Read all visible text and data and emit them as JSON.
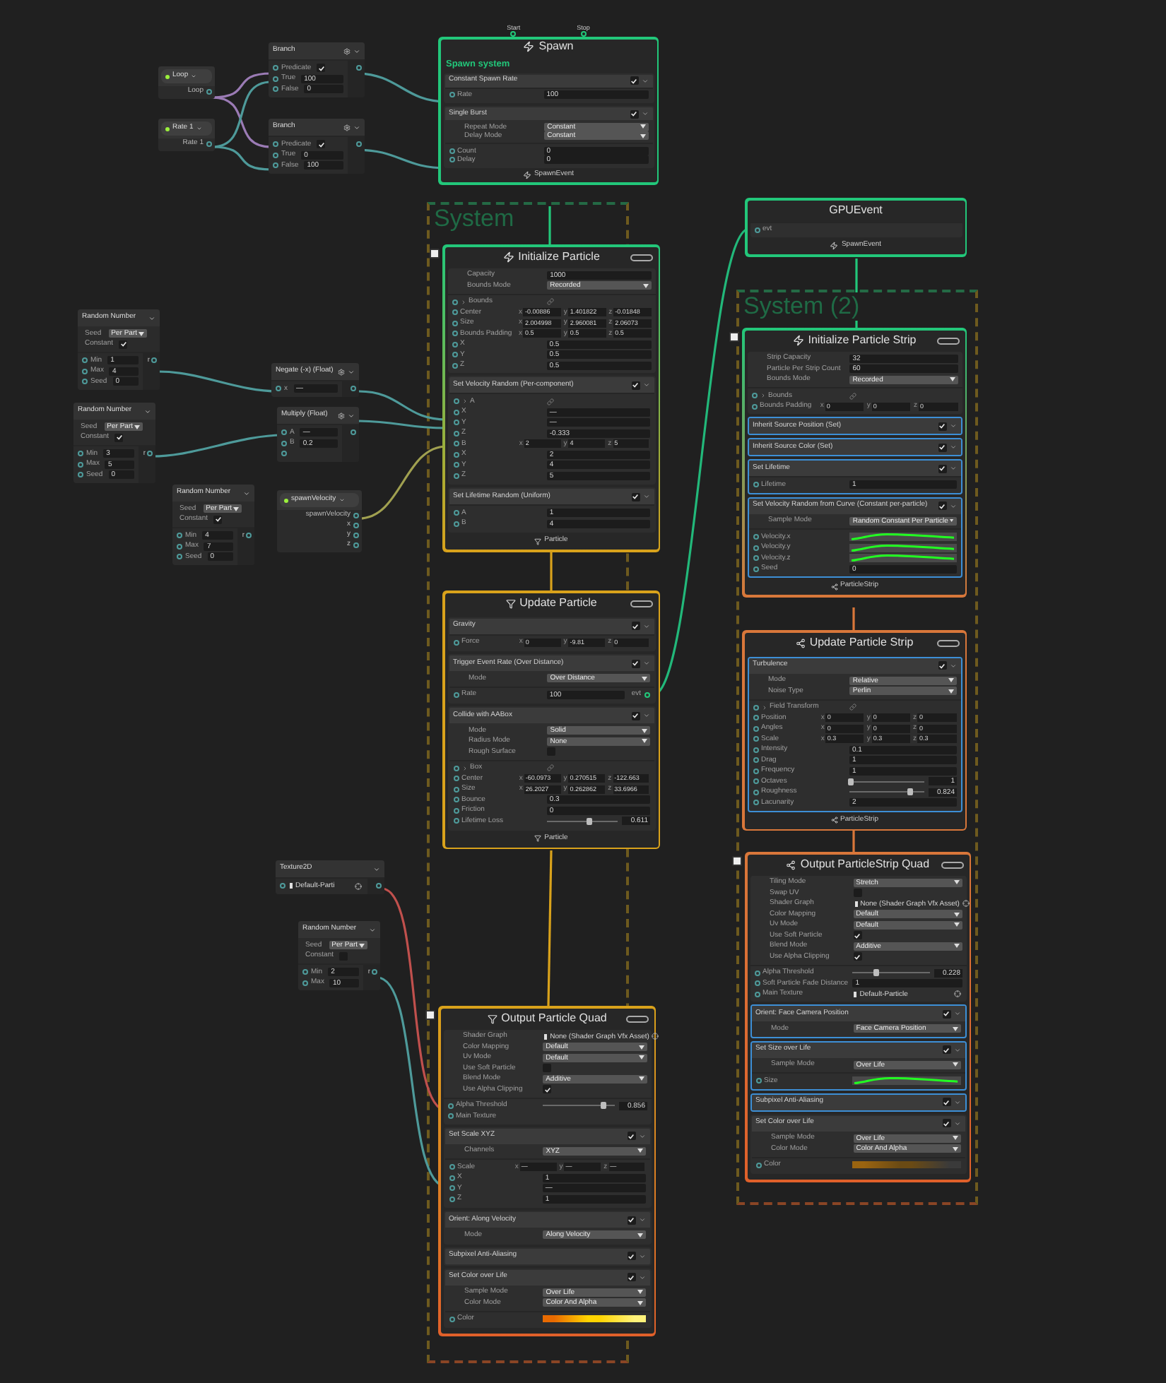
{
  "systems": [
    {
      "label": "System"
    },
    {
      "label": "System (2)"
    }
  ],
  "operators": [
    {
      "kind": "property",
      "name": "Loop",
      "outputs": [
        "Loop"
      ]
    },
    {
      "kind": "property",
      "name": "Rate 1",
      "outputs": [
        "Rate 1"
      ]
    },
    {
      "kind": "node",
      "title": "Branch",
      "settings_icon": true,
      "inputs": [
        {
          "kind": "check",
          "label": "Predicate",
          "checked": true
        },
        {
          "kind": "value",
          "label": "True",
          "value": "100"
        },
        {
          "kind": "value",
          "label": "False",
          "value": "0"
        }
      ]
    },
    {
      "kind": "node",
      "title": "Branch",
      "settings_icon": true,
      "inputs": [
        {
          "kind": "check",
          "label": "Predicate",
          "checked": true
        },
        {
          "kind": "value",
          "label": "True",
          "value": "0"
        },
        {
          "kind": "value",
          "label": "False",
          "value": "100"
        }
      ]
    },
    {
      "kind": "node",
      "title": "Random Number",
      "settings_icon": false,
      "settings": [
        {
          "kind": "dropdown",
          "label": "Seed",
          "value": "Per Part"
        },
        {
          "kind": "check",
          "label": "Constant",
          "checked": true
        }
      ],
      "inputs": [
        {
          "kind": "value",
          "label": "Min",
          "value": "1"
        },
        {
          "kind": "value",
          "label": "Max",
          "value": "4"
        },
        {
          "kind": "value",
          "label": "Seed",
          "value": "0"
        }
      ],
      "output": "r"
    },
    {
      "kind": "node",
      "title": "Random Number",
      "settings_icon": false,
      "settings": [
        {
          "kind": "dropdown",
          "label": "Seed",
          "value": "Per Part"
        },
        {
          "kind": "check",
          "label": "Constant",
          "checked": true
        }
      ],
      "inputs": [
        {
          "kind": "value",
          "label": "Min",
          "value": "3"
        },
        {
          "kind": "value",
          "label": "Max",
          "value": "5"
        },
        {
          "kind": "value",
          "label": "Seed",
          "value": "0"
        }
      ],
      "output": "r"
    },
    {
      "kind": "node",
      "title": "Random Number",
      "settings_icon": false,
      "settings": [
        {
          "kind": "dropdown",
          "label": "Seed",
          "value": "Per Part"
        },
        {
          "kind": "check",
          "label": "Constant",
          "checked": true
        }
      ],
      "inputs": [
        {
          "kind": "value",
          "label": "Min",
          "value": "4"
        },
        {
          "kind": "value",
          "label": "Max",
          "value": "7"
        },
        {
          "kind": "value",
          "label": "Seed",
          "value": "0"
        }
      ],
      "output": "r"
    },
    {
      "kind": "node",
      "title": "Negate (-x) (Float)",
      "settings_icon": true,
      "inputs": [
        {
          "kind": "value",
          "label": "x",
          "value": "—"
        }
      ]
    },
    {
      "kind": "node",
      "title": "Multiply (Float)",
      "settings_icon": true,
      "inputs": [
        {
          "kind": "value",
          "label": "A",
          "value": "—"
        },
        {
          "kind": "value",
          "label": "B",
          "value": "0.2"
        },
        {
          "kind": "empty"
        }
      ]
    },
    {
      "kind": "property",
      "name": "spawnVelocity",
      "outputs": [
        "spawnVelocity",
        "x",
        "y",
        "z"
      ]
    },
    {
      "kind": "node",
      "title": "Texture2D",
      "settings_icon": false,
      "inputs": [
        {
          "kind": "object",
          "value": "Default-Parti"
        }
      ]
    },
    {
      "kind": "node",
      "title": "Random Number",
      "settings_icon": false,
      "settings": [
        {
          "kind": "dropdown",
          "label": "Seed",
          "value": "Per Part"
        },
        {
          "kind": "check",
          "label": "Constant",
          "checked": false
        }
      ],
      "inputs": [
        {
          "kind": "value",
          "label": "Min",
          "value": "2"
        },
        {
          "kind": "value",
          "label": "Max",
          "value": "10"
        }
      ],
      "output": "r"
    }
  ],
  "contexts": [
    {
      "kind": "spawn",
      "strip": false,
      "title": "Spawn",
      "top_ports": [
        "Start",
        "Stop"
      ],
      "subtitle": "Spawn system",
      "blocks": [
        {
          "title": "Constant Spawn Rate",
          "enabled": true,
          "selected": false,
          "inputs": [
            {
              "kind": "value",
              "label": "Rate",
              "value": "100"
            }
          ]
        },
        {
          "title": "Single Burst",
          "enabled": true,
          "selected": false,
          "settings": [
            {
              "kind": "dropdown",
              "label": "Repeat Mode",
              "value": "Constant"
            },
            {
              "kind": "dropdown",
              "label": "Delay Mode",
              "value": "Constant"
            }
          ],
          "inputs": [
            {
              "kind": "value",
              "label": "Count",
              "value": "0"
            },
            {
              "kind": "value",
              "label": "Delay",
              "value": "0"
            }
          ]
        }
      ],
      "footer": "SpawnEvent"
    },
    {
      "kind": "initialize",
      "strip": false,
      "title": "Initialize Particle",
      "settings": [
        {
          "kind": "value",
          "label": "Capacity",
          "value": "1000"
        },
        {
          "kind": "dropdown",
          "label": "Bounds Mode",
          "value": "Recorded"
        }
      ],
      "inputs": [
        {
          "kind": "group",
          "label": "Bounds"
        },
        {
          "kind": "vector",
          "label": "Center",
          "components": [
            {
              "axis": "x",
              "value": "-0.00886"
            },
            {
              "axis": "y",
              "value": "1.401822"
            },
            {
              "axis": "z",
              "value": "-0.01848"
            }
          ]
        },
        {
          "kind": "vector",
          "label": "Size",
          "components": [
            {
              "axis": "x",
              "value": "2.004998"
            },
            {
              "axis": "y",
              "value": "2.960081"
            },
            {
              "axis": "z",
              "value": "2.06073"
            }
          ]
        },
        {
          "kind": "vector",
          "label": "Bounds Padding",
          "components": [
            {
              "axis": "x",
              "value": "0.5"
            },
            {
              "axis": "y",
              "value": "0.5"
            },
            {
              "axis": "z",
              "value": "0.5"
            }
          ]
        },
        {
          "kind": "value",
          "label": "X",
          "value": "0.5"
        },
        {
          "kind": "value",
          "label": "Y",
          "value": "0.5"
        },
        {
          "kind": "value",
          "label": "Z",
          "value": "0.5"
        }
      ],
      "blocks": [
        {
          "title": "Set Velocity Random (Per-component)",
          "enabled": true,
          "selected": false,
          "inputs": [
            {
              "kind": "group",
              "label": "A"
            },
            {
              "kind": "value",
              "label": "X",
              "value": "—"
            },
            {
              "kind": "value",
              "label": "Y",
              "value": "—"
            },
            {
              "kind": "value",
              "label": "Z",
              "value": "-0.333"
            },
            {
              "kind": "vector",
              "label": "B",
              "components": [
                {
                  "axis": "x",
                  "value": "2"
                },
                {
                  "axis": "y",
                  "value": "4"
                },
                {
                  "axis": "z",
                  "value": "5"
                }
              ]
            },
            {
              "kind": "value",
              "label": "X",
              "value": "2"
            },
            {
              "kind": "value",
              "label": "Y",
              "value": "4"
            },
            {
              "kind": "value",
              "label": "Z",
              "value": "5"
            }
          ]
        },
        {
          "title": "Set Lifetime Random (Uniform)",
          "enabled": true,
          "selected": false,
          "inputs": [
            {
              "kind": "value",
              "label": "A",
              "value": "1"
            },
            {
              "kind": "value",
              "label": "B",
              "value": "4"
            }
          ]
        }
      ],
      "footer": "Particle"
    },
    {
      "kind": "update",
      "strip": false,
      "title": "Update Particle",
      "blocks": [
        {
          "title": "Gravity",
          "enabled": true,
          "selected": false,
          "inputs": [
            {
              "kind": "vector",
              "label": "Force",
              "components": [
                {
                  "axis": "x",
                  "value": "0"
                },
                {
                  "axis": "y",
                  "value": "-9.81"
                },
                {
                  "axis": "z",
                  "value": "0"
                }
              ]
            }
          ]
        },
        {
          "title": "Trigger Event Rate (Over Distance)",
          "enabled": true,
          "selected": false,
          "settings": [
            {
              "kind": "dropdown",
              "label": "Mode",
              "value": "Over Distance"
            }
          ],
          "inputs": [
            {
              "kind": "value",
              "label": "Rate",
              "value": "100",
              "output": "evt"
            }
          ]
        },
        {
          "title": "Collide with AABox",
          "enabled": true,
          "selected": false,
          "settings": [
            {
              "kind": "dropdown",
              "label": "Mode",
              "value": "Solid"
            },
            {
              "kind": "dropdown",
              "label": "Radius Mode",
              "value": "None"
            },
            {
              "kind": "check",
              "label": "Rough Surface",
              "checked": false
            }
          ],
          "inputs": [
            {
              "kind": "group",
              "label": "Box"
            },
            {
              "kind": "vector",
              "label": "Center",
              "components": [
                {
                  "axis": "x",
                  "value": "-60.0973"
                },
                {
                  "axis": "y",
                  "value": "0.270515"
                },
                {
                  "axis": "z",
                  "value": "-122.663"
                }
              ]
            },
            {
              "kind": "vector",
              "label": "Size",
              "components": [
                {
                  "axis": "x",
                  "value": "26.2027"
                },
                {
                  "axis": "y",
                  "value": "0.262862"
                },
                {
                  "axis": "z",
                  "value": "33.6966"
                }
              ]
            },
            {
              "kind": "value",
              "label": "Bounce",
              "value": "0.3"
            },
            {
              "kind": "value",
              "label": "Friction",
              "value": "0"
            },
            {
              "kind": "slider",
              "label": "Lifetime Loss",
              "level": 0.61,
              "reading": "0.611"
            }
          ]
        }
      ],
      "footer": "Particle"
    },
    {
      "kind": "output",
      "strip": false,
      "title": "Output Particle Quad",
      "settings": [
        {
          "kind": "object",
          "label": "Shader Graph",
          "value": "None (Shader Graph Vfx Asset)"
        },
        {
          "kind": "dropdown",
          "label": "Color Mapping",
          "value": "Default"
        },
        {
          "kind": "dropdown",
          "label": "Uv Mode",
          "value": "Default"
        },
        {
          "kind": "check",
          "label": "Use Soft Particle",
          "checked": false
        },
        {
          "kind": "dropdown",
          "label": "Blend Mode",
          "value": "Additive"
        },
        {
          "kind": "check",
          "label": "Use Alpha Clipping",
          "checked": true
        }
      ],
      "inputs": [
        {
          "kind": "slider",
          "label": "Alpha Threshold",
          "level": 0.86,
          "reading": "0.856"
        },
        {
          "kind": "label",
          "label": "Main Texture"
        }
      ],
      "blocks": [
        {
          "title": "Set Scale XYZ",
          "enabled": true,
          "selected": false,
          "settings": [
            {
              "kind": "dropdown",
              "label": "Channels",
              "value": "XYZ"
            }
          ],
          "inputs": [
            {
              "kind": "vector",
              "label": "Scale",
              "components": [
                {
                  "axis": "x",
                  "value": "—"
                },
                {
                  "axis": "y",
                  "value": "—"
                },
                {
                  "axis": "z",
                  "value": "—"
                }
              ]
            },
            {
              "kind": "value",
              "label": "X",
              "value": "1"
            },
            {
              "kind": "value",
              "label": "Y",
              "value": "—"
            },
            {
              "kind": "value",
              "label": "Z",
              "value": "1"
            }
          ]
        },
        {
          "title": "Orient: Along Velocity",
          "enabled": true,
          "selected": false,
          "settings": [
            {
              "kind": "dropdown",
              "label": "Mode",
              "value": "Along Velocity"
            }
          ]
        },
        {
          "title": "Subpixel Anti-Aliasing",
          "enabled": true,
          "selected": false
        },
        {
          "title": "Set Color over Life",
          "enabled": true,
          "selected": false,
          "settings": [
            {
              "kind": "dropdown",
              "label": "Sample Mode",
              "value": "Over Life"
            },
            {
              "kind": "dropdown",
              "label": "Color Mode",
              "value": "Color And Alpha"
            }
          ],
          "inputs": [
            {
              "kind": "gradient",
              "label": "Color",
              "stops": [
                {
                  "color": "#e86a00"
                },
                {
                  "color": "#ffd400"
                },
                {
                  "color": "#fff27a"
                }
              ]
            }
          ]
        }
      ]
    },
    {
      "kind": "event",
      "strip": false,
      "title": "GPUEvent",
      "inputs": [
        {
          "kind": "label",
          "label": "evt"
        }
      ],
      "footer": "SpawnEvent"
    },
    {
      "kind": "initialize",
      "strip": true,
      "title": "Initialize Particle Strip",
      "settings": [
        {
          "kind": "value",
          "label": "Strip Capacity",
          "value": "32"
        },
        {
          "kind": "value",
          "label": "Particle Per Strip Count",
          "value": "60"
        },
        {
          "kind": "dropdown",
          "label": "Bounds Mode",
          "value": "Recorded"
        }
      ],
      "inputs": [
        {
          "kind": "group",
          "label": "Bounds"
        },
        {
          "kind": "vector",
          "label": "Bounds Padding",
          "components": [
            {
              "axis": "x",
              "value": "0"
            },
            {
              "axis": "y",
              "value": "0"
            },
            {
              "axis": "z",
              "value": "0"
            }
          ]
        }
      ],
      "blocks": [
        {
          "title": "Inherit Source Position (Set)",
          "enabled": true,
          "selected": true
        },
        {
          "title": "Inherit Source Color (Set)",
          "enabled": true,
          "selected": true
        },
        {
          "title": "Set Lifetime",
          "enabled": true,
          "selected": true,
          "inputs": [
            {
              "kind": "value",
              "label": "Lifetime",
              "value": "1"
            }
          ]
        },
        {
          "title": "Set Velocity Random from Curve (Constant per-particle)",
          "enabled": true,
          "selected": true,
          "settings": [
            {
              "kind": "dropdown",
              "label": "Sample Mode",
              "value": "Random Constant Per Particle"
            }
          ],
          "inputs": [
            {
              "kind": "curve",
              "label": "Velocity.x"
            },
            {
              "kind": "curve",
              "label": "Velocity.y"
            },
            {
              "kind": "curve",
              "label": "Velocity.z"
            },
            {
              "kind": "value",
              "label": "Seed",
              "value": "0"
            }
          ]
        }
      ],
      "footer": "ParticleStrip"
    },
    {
      "kind": "update",
      "strip": true,
      "title": "Update Particle Strip",
      "blocks": [
        {
          "title": "Turbulence",
          "enabled": true,
          "selected": true,
          "settings": [
            {
              "kind": "dropdown",
              "label": "Mode",
              "value": "Relative"
            },
            {
              "kind": "dropdown",
              "label": "Noise Type",
              "value": "Perlin"
            }
          ],
          "inputs": [
            {
              "kind": "group",
              "label": "Field Transform"
            },
            {
              "kind": "vector",
              "label": "Position",
              "components": [
                {
                  "axis": "x",
                  "value": "0"
                },
                {
                  "axis": "y",
                  "value": "0"
                },
                {
                  "axis": "z",
                  "value": "0"
                }
              ]
            },
            {
              "kind": "vector",
              "label": "Angles",
              "components": [
                {
                  "axis": "x",
                  "value": "0"
                },
                {
                  "axis": "y",
                  "value": "0"
                },
                {
                  "axis": "z",
                  "value": "0"
                }
              ]
            },
            {
              "kind": "vector",
              "label": "Scale",
              "components": [
                {
                  "axis": "x",
                  "value": "0.3"
                },
                {
                  "axis": "y",
                  "value": "0.3"
                },
                {
                  "axis": "z",
                  "value": "0.3"
                }
              ]
            },
            {
              "kind": "value",
              "label": "Intensity",
              "value": "0.1"
            },
            {
              "kind": "value",
              "label": "Drag",
              "value": "1"
            },
            {
              "kind": "value",
              "label": "Frequency",
              "value": "1"
            },
            {
              "kind": "slider",
              "label": "Octaves",
              "level": 0.02,
              "reading": "1"
            },
            {
              "kind": "slider",
              "label": "Roughness",
              "level": 0.82,
              "reading": "0.824"
            },
            {
              "kind": "value",
              "label": "Lacunarity",
              "value": "2"
            }
          ]
        }
      ],
      "footer": "ParticleStrip"
    },
    {
      "kind": "output",
      "strip": true,
      "title": "Output ParticleStrip Quad",
      "settings": [
        {
          "kind": "dropdown",
          "label": "Tiling Mode",
          "value": "Stretch"
        },
        {
          "kind": "check",
          "label": "Swap UV",
          "checked": false
        },
        {
          "kind": "object",
          "label": "Shader Graph",
          "value": "None (Shader Graph Vfx Asset)"
        },
        {
          "kind": "dropdown",
          "label": "Color Mapping",
          "value": "Default"
        },
        {
          "kind": "dropdown",
          "label": "Uv Mode",
          "value": "Default"
        },
        {
          "kind": "check",
          "label": "Use Soft Particle",
          "checked": true
        },
        {
          "kind": "dropdown",
          "label": "Blend Mode",
          "value": "Additive"
        },
        {
          "kind": "check",
          "label": "Use Alpha Clipping",
          "checked": true
        }
      ],
      "inputs": [
        {
          "kind": "slider",
          "label": "Alpha Threshold",
          "level": 0.3,
          "reading": "0.228"
        },
        {
          "kind": "value",
          "label": "Soft Particle Fade Distance",
          "value": "1"
        },
        {
          "kind": "object",
          "label": "Main Texture",
          "value": "Default-Particle"
        }
      ],
      "blocks": [
        {
          "title": "Orient: Face Camera Position",
          "enabled": true,
          "selected": true,
          "settings": [
            {
              "kind": "dropdown",
              "label": "Mode",
              "value": "Face Camera Position"
            }
          ]
        },
        {
          "title": "Set Size over Life",
          "enabled": true,
          "selected": true,
          "settings": [
            {
              "kind": "dropdown",
              "label": "Sample Mode",
              "value": "Over Life"
            }
          ],
          "inputs": [
            {
              "kind": "curve",
              "label": "Size"
            }
          ]
        },
        {
          "title": "Subpixel Anti-Aliasing",
          "enabled": true,
          "selected": true
        },
        {
          "title": "Set Color over Life",
          "enabled": true,
          "selected": false,
          "settings": [
            {
              "kind": "dropdown",
              "label": "Sample Mode",
              "value": "Over Life"
            },
            {
              "kind": "dropdown",
              "label": "Color Mode",
              "value": "Color And Alpha"
            }
          ],
          "inputs": [
            {
              "kind": "gradient",
              "label": "Color",
              "stops": [
                {
                  "color": "#9a6410"
                },
                {
                  "color": "#6a4a14"
                },
                {
                  "color": "#3a3a3a"
                }
              ]
            }
          ]
        }
      ]
    }
  ]
}
